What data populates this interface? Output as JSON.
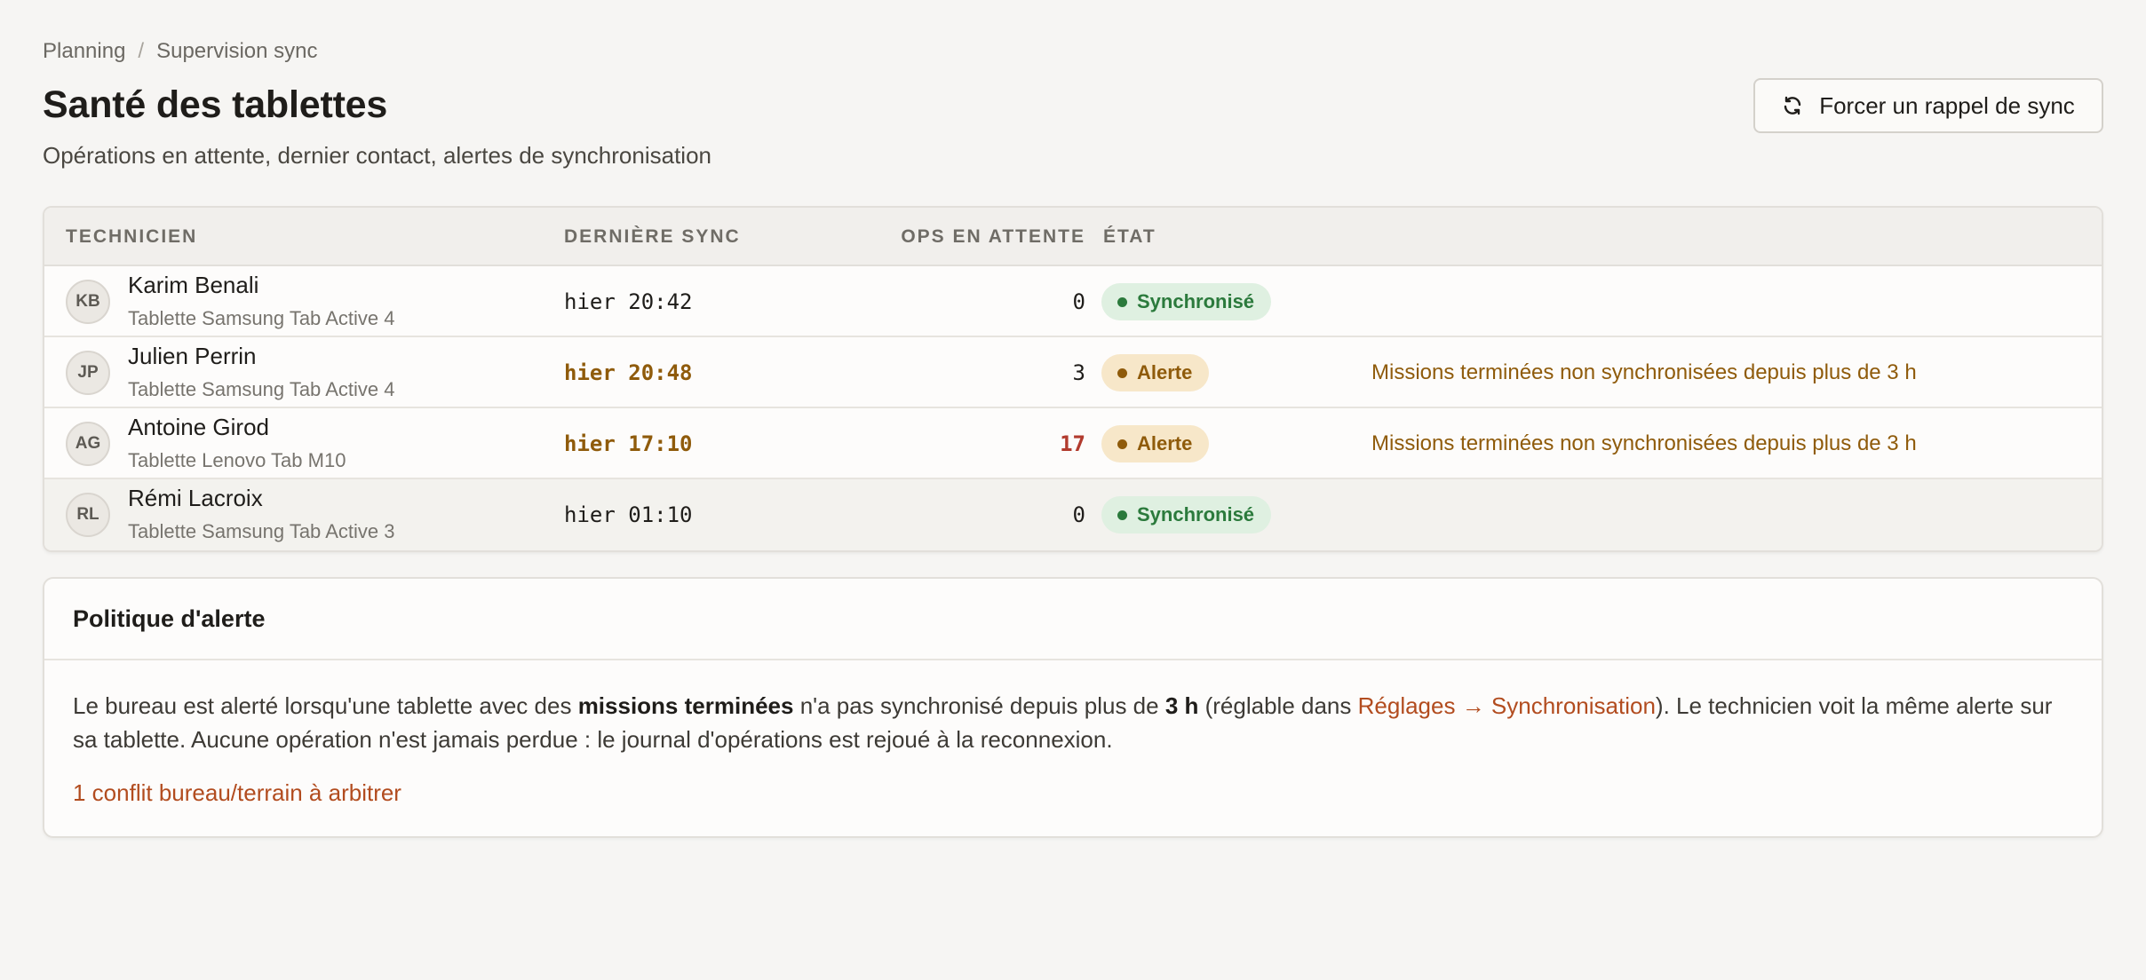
{
  "breadcrumb": {
    "items": [
      "Planning",
      "Supervision sync"
    ],
    "separator": "/"
  },
  "header": {
    "title": "Santé des tablettes",
    "subtitle": "Opérations en attente, dernier contact, alertes de synchronisation",
    "sync_button_label": "Forcer un rappel de sync",
    "sync_button_icon": "refresh-icon"
  },
  "table": {
    "columns": [
      "Technicien",
      "Dernière sync",
      "Ops en attente",
      "État"
    ],
    "rows": [
      {
        "initials": "KB",
        "name": "Karim Benali",
        "device": "Tablette Samsung Tab Active 4",
        "last_sync": "hier 20:42",
        "pending": "0",
        "status": "Synchronisé",
        "status_kind": "ok",
        "alert": ""
      },
      {
        "initials": "JP",
        "name": "Julien Perrin",
        "device": "Tablette Samsung Tab Active 4",
        "last_sync": "hier 20:48",
        "pending": "3",
        "status": "Alerte",
        "status_kind": "warn",
        "alert": "Missions terminées non synchronisées depuis plus de 3 h"
      },
      {
        "initials": "AG",
        "name": "Antoine Girod",
        "device": "Tablette Lenovo Tab M10",
        "last_sync": "hier 17:10",
        "pending": "17",
        "status": "Alerte",
        "status_kind": "warn",
        "alert": "Missions terminées non synchronisées depuis plus de 3 h"
      },
      {
        "initials": "RL",
        "name": "Rémi Lacroix",
        "device": "Tablette Samsung Tab Active 3",
        "last_sync": "hier 01:10",
        "pending": "0",
        "status": "Synchronisé",
        "status_kind": "ok",
        "alert": ""
      }
    ]
  },
  "policy": {
    "title": "Politique d'alerte",
    "text_1": "Le bureau est alerté lorsqu'une tablette avec des ",
    "text_bold_1": "missions terminées",
    "text_2": " n'a pas synchronisé depuis plus de ",
    "text_bold_2": "3 h",
    "text_3": " (réglable dans ",
    "settings_link": "Réglages → Synchronisation",
    "text_4": "). Le technicien voit la même alerte sur sa tablette. Aucune opération n'est jamais perdue : le journal d'opérations est rejoué à la reconnexion.",
    "conflict_link": "1 conflit bureau/terrain à arbitrer"
  },
  "colors": {
    "accent_link": "#b24c1f",
    "status_ok": "#2b7a3c",
    "status_warn": "#8f5b0b",
    "pending_danger": "#b23b2e"
  }
}
